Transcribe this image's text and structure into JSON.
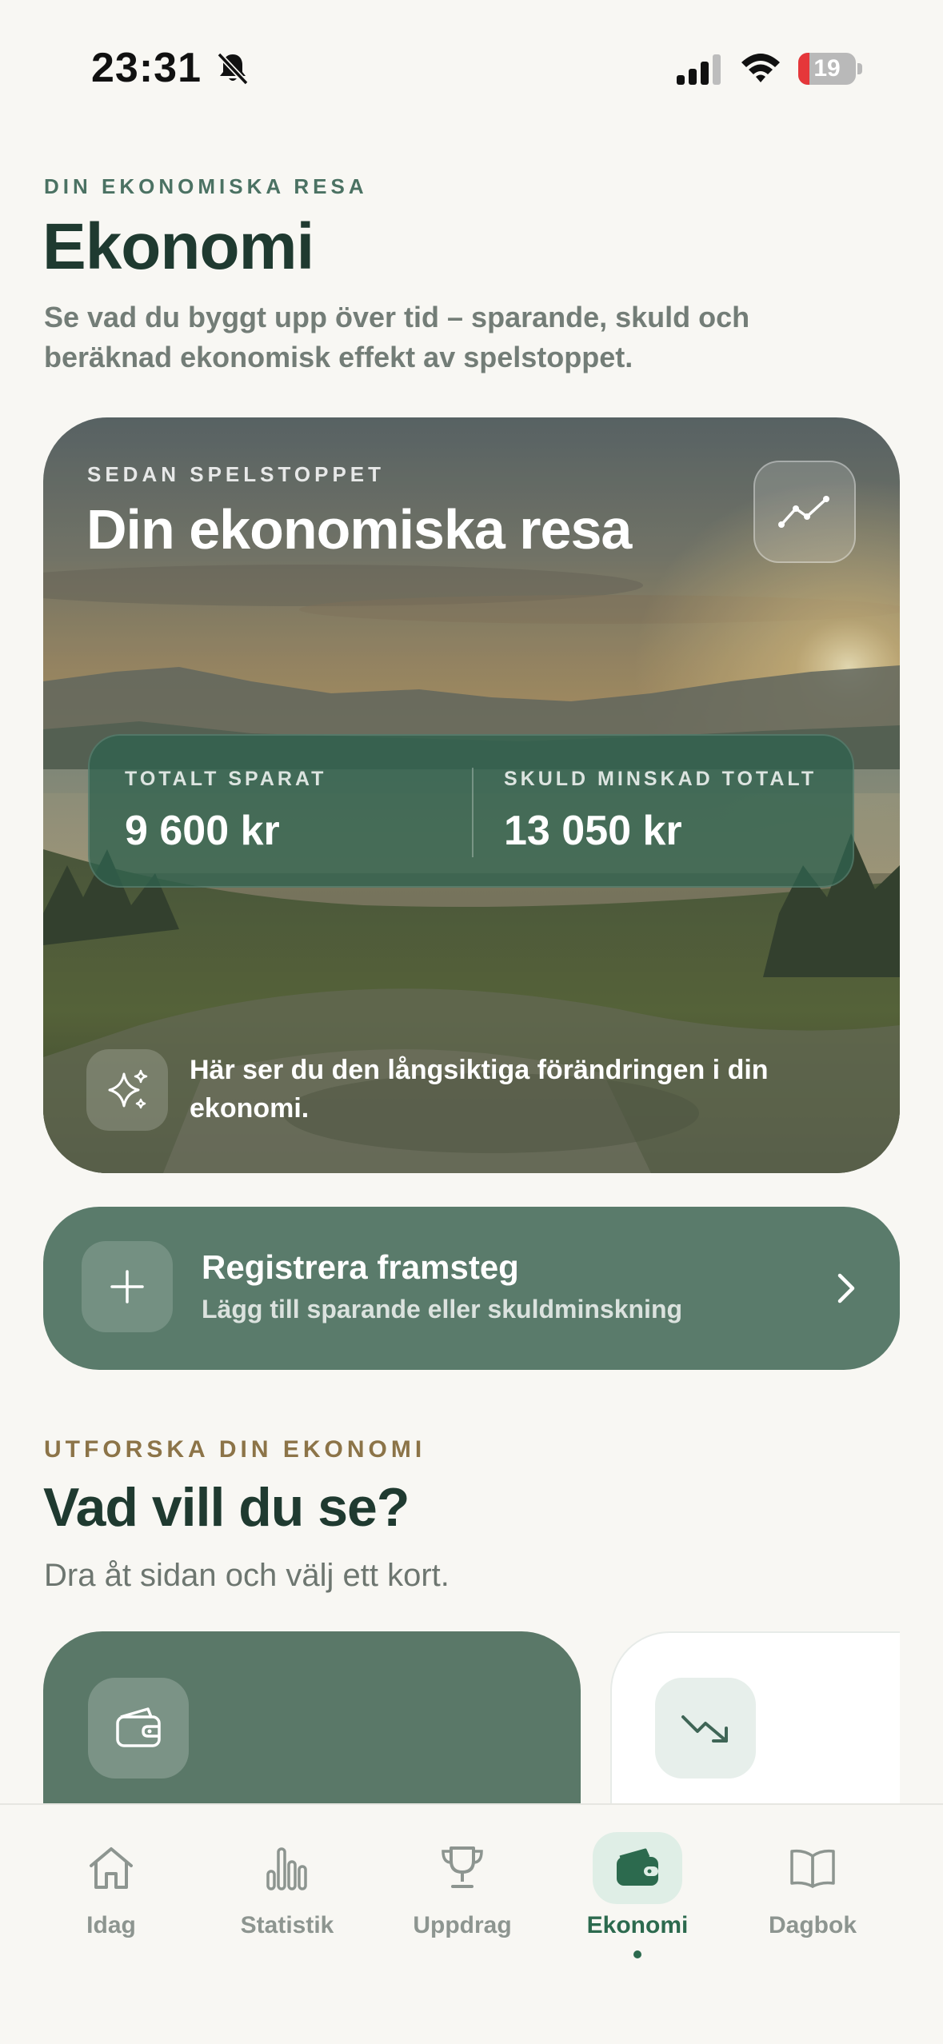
{
  "status_bar": {
    "time": "23:31",
    "battery": "19",
    "battery_level": 0.19
  },
  "header": {
    "eyebrow": "DIN EKONOMISKA RESA",
    "title": "Ekonomi",
    "subtitle": "Se vad du byggt upp över tid – sparande, skuld och beräknad ekonomisk effekt av spelstoppet."
  },
  "hero": {
    "eyebrow": "SEDAN SPELSTOPPET",
    "title": "Din ekonomiska resa",
    "trend_icon": "trend-line-icon",
    "stats": [
      {
        "label": "TOTALT SPARAT",
        "value": "9 600 kr"
      },
      {
        "label": "SKULD MINSKAD TOTALT",
        "value": "13 050 kr"
      }
    ],
    "note_icon": "sparkles-icon",
    "note": "Här ser du den långsiktiga förändringen i din ekonomi."
  },
  "register": {
    "title": "Registrera framsteg",
    "subtitle": "Lägg till sparande eller skuldminskning",
    "icon": "plus-icon"
  },
  "explore": {
    "eyebrow": "UTFORSKA DIN EKONOMI",
    "title": "Vad vill du se?",
    "subtitle": "Dra åt sidan och välj ett kort.",
    "cards": [
      {
        "icon": "wallet-icon"
      },
      {
        "icon": "trending-down-icon"
      }
    ]
  },
  "tabs": [
    {
      "label": "Idag",
      "icon": "home-icon",
      "active": false
    },
    {
      "label": "Statistik",
      "icon": "bar-chart-icon",
      "active": false
    },
    {
      "label": "Uppdrag",
      "icon": "trophy-icon",
      "active": false
    },
    {
      "label": "Ekonomi",
      "icon": "wallet-icon",
      "active": true
    },
    {
      "label": "Dagbok",
      "icon": "book-icon",
      "active": false
    }
  ],
  "colors": {
    "background": "#f8f7f3",
    "primary_green": "#5a7b6b",
    "accent_green": "#2c6a4e",
    "title_dark": "#1f3a30",
    "eyebrow_gold": "#8c7448"
  }
}
